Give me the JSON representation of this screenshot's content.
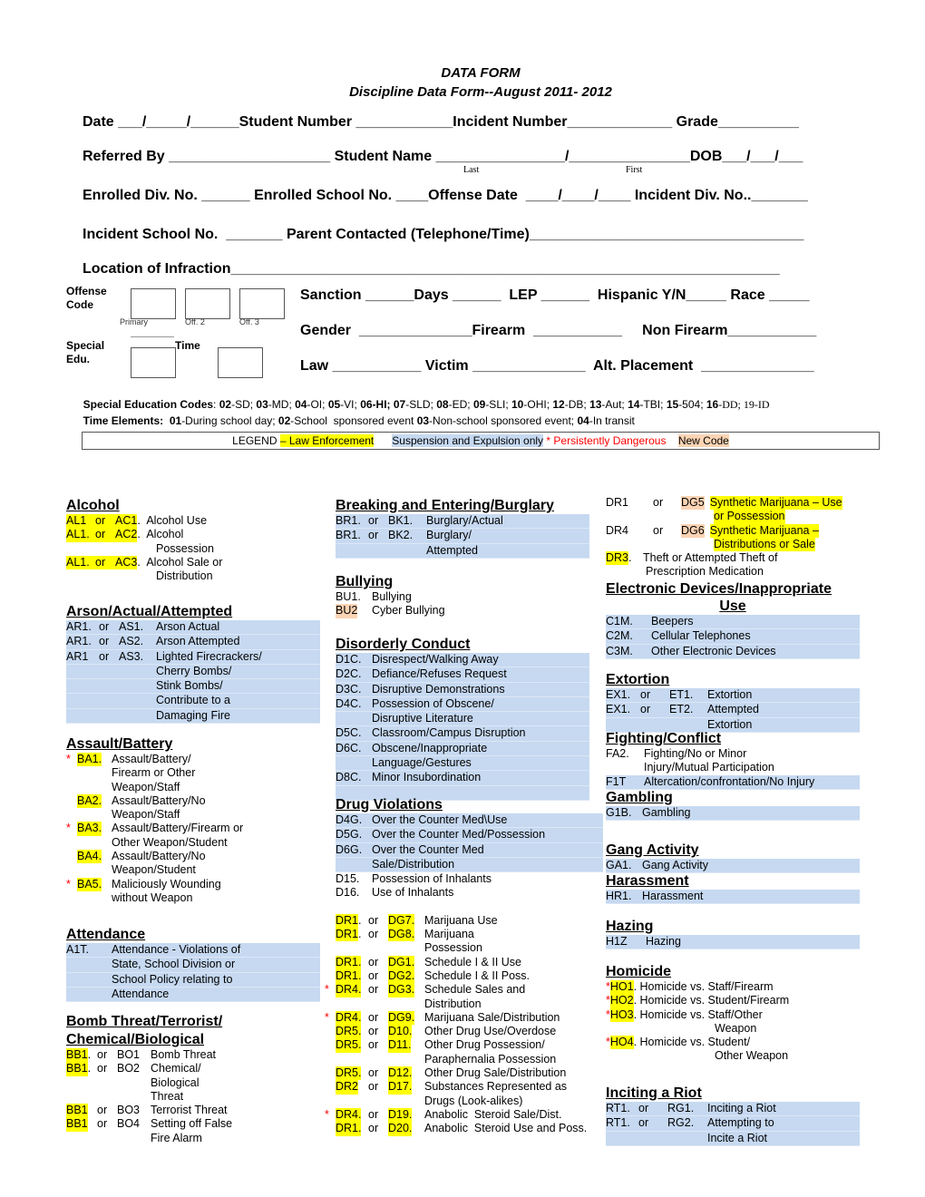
{
  "header": {
    "title": "DATA FORM",
    "subtitle": "Discipline Data Form--August 2011- 2012"
  },
  "form_rows": [
    "Date ___/_____/______Student Number ____________Incident Number_____________ Grade__________",
    "Referred By ____________________ Student Name ________________/_______________DOB___/___/___",
    "Enrolled Div. No. ______ Enrolled School No. ____Offense Date  ____/____/____ Incident Div. No.._______",
    "Incident School No.  _______ Parent Contacted (Telephone/Time)__________________________________",
    "Location of Infraction____________________________________________________________________"
  ],
  "name_sublabels": {
    "last": "Last",
    "first": "First"
  },
  "offense_code": {
    "label_line1": "Offense",
    "label_line2": "Code",
    "boxes": [
      "Primary",
      "Off. 2",
      "Off. 3"
    ]
  },
  "special_edu": {
    "label_line1": "Special",
    "label_line2": "Edu.",
    "time_label": "Time"
  },
  "right_fields": [
    "Sanction ______Days ______  LEP ______  Hispanic Y/N_____ Race _____",
    "Gender  ______________Firearm  ___________     Non Firearm___________",
    "Law ___________ Victim ______________  Alt. Placement  ______________"
  ],
  "special_education_codes": {
    "label": "Special Education Codes",
    "items": [
      {
        "code": "02",
        "desc": "SD"
      },
      {
        "code": "03",
        "desc": "MD"
      },
      {
        "code": "04",
        "desc": "OI"
      },
      {
        "code": "05",
        "desc": "VI"
      },
      {
        "code": "06",
        "desc": "HI"
      },
      {
        "code": "07",
        "desc": "SLD"
      },
      {
        "code": "08",
        "desc": "ED"
      },
      {
        "code": "09",
        "desc": "SLI"
      },
      {
        "code": "10",
        "desc": "OHI"
      },
      {
        "code": "12",
        "desc": "DB"
      },
      {
        "code": "13",
        "desc": "Aut"
      },
      {
        "code": "14",
        "desc": "TBI"
      },
      {
        "code": "15",
        "desc": "504"
      },
      {
        "code": "16",
        "desc": "DD"
      },
      {
        "code": "19",
        "desc": "ID"
      }
    ]
  },
  "time_elements": {
    "label": "Time Elements:",
    "items": [
      {
        "code": "01",
        "desc": "During school day; "
      },
      {
        "code": "02",
        "desc": "School  sponsored event "
      },
      {
        "code": "03",
        "desc": "Non-school sponsored event; "
      },
      {
        "code": "04",
        "desc": "In transit"
      }
    ]
  },
  "legend": {
    "label": "LEGEND",
    "law": "– Law Enforcement",
    "suspension": "Suspension and Expulsion only",
    "dangerous": "* Persistently Dangerous",
    "new_code": "New Code"
  },
  "colors": {
    "law_enforcement": "#ffff00",
    "suspension_expulsion": "#c6d9f1",
    "persistently_dangerous": "#ff0000",
    "new_code": "#fbd4b4"
  },
  "sections": {
    "alcohol": {
      "title": "Alcohol",
      "rows": [
        {
          "a": "AL1",
          "or": "or",
          "b": "AC1",
          "desc": "Alcohol Use"
        },
        {
          "a": "AL1.",
          "or": "or",
          "b": "AC2",
          "desc": "Alcohol"
        },
        {
          "a": "",
          "or": "",
          "b": "",
          "desc": "Possession"
        },
        {
          "a": "AL1.",
          "or": "or",
          "b": "AC3",
          "desc": "Alcohol Sale or"
        },
        {
          "a": "",
          "or": "",
          "b": "",
          "desc": "Distribution"
        }
      ]
    },
    "arson": {
      "title": "Arson/Actual/Attempted",
      "rows": [
        {
          "a": "AR1.",
          "or": "or",
          "b": "AS1.",
          "desc": "Arson Actual"
        },
        {
          "a": "AR1.",
          "or": "or",
          "b": "AS2.",
          "desc": "Arson Attempted"
        },
        {
          "a": "AR1",
          "or": "or",
          "b": "AS3.",
          "desc": "Lighted Firecrackers/"
        },
        {
          "a": "",
          "or": "",
          "b": "",
          "desc": "Cherry Bombs/"
        },
        {
          "a": "",
          "or": "",
          "b": "",
          "desc": "Stink Bombs/"
        },
        {
          "a": "",
          "or": "",
          "b": "",
          "desc": "Contribute to a"
        },
        {
          "a": "",
          "or": "",
          "b": "",
          "desc": "Damaging Fire"
        }
      ]
    },
    "assault": {
      "title": "Assault/Battery",
      "rows": [
        {
          "mark": "*",
          "code": "BA1.",
          "desc": "Assault/Battery/"
        },
        {
          "mark": "",
          "code": "",
          "desc": "Firearm or Other"
        },
        {
          "mark": "",
          "code": "",
          "desc": "Weapon/Staff"
        },
        {
          "mark": "",
          "code": "BA2.",
          "desc": "Assault/Battery/No"
        },
        {
          "mark": "",
          "code": "",
          "desc": "Weapon/Staff"
        },
        {
          "mark": "*",
          "code": "BA3.",
          "desc": "Assault/Battery/Firearm or"
        },
        {
          "mark": "",
          "code": "",
          "desc": "Other Weapon/Student"
        },
        {
          "mark": "",
          "code": "BA4.",
          "desc": "Assault/Battery/No"
        },
        {
          "mark": "",
          "code": "",
          "desc": "Weapon/Student"
        },
        {
          "mark": "*",
          "code": "BA5.",
          "desc": "Maliciously Wounding"
        },
        {
          "mark": "",
          "code": "",
          "desc": "without Weapon"
        }
      ]
    },
    "attendance": {
      "title": "Attendance",
      "rows": [
        {
          "code": "A1T.",
          "desc": "Attendance - Violations of"
        },
        {
          "code": "",
          "desc": "State, School Division or"
        },
        {
          "code": "",
          "desc": "School Policy relating to"
        },
        {
          "code": "",
          "desc": "Attendance"
        }
      ]
    },
    "bomb": {
      "title_line1": "Bomb Threat/Terrorist/",
      "title_line2": "Chemical/Biological",
      "rows": [
        {
          "a": "BB1",
          "dot": ".",
          "or": "or",
          "b": "BO1",
          "desc": "Bomb Threat"
        },
        {
          "a": "BB1",
          "dot": ".",
          "or": "or",
          "b": "BO2",
          "desc": "Chemical/"
        },
        {
          "a": "",
          "dot": "",
          "or": "",
          "b": "",
          "desc": "Biological"
        },
        {
          "a": "",
          "dot": "",
          "or": "",
          "b": "",
          "desc": "Threat"
        },
        {
          "a": "BB1",
          "dot": "",
          "or": "or",
          "b": "BO3",
          "desc": "Terrorist Threat"
        },
        {
          "a": "BB1",
          "dot": "",
          "or": "or",
          "b": "BO4",
          "desc": "Setting off False"
        },
        {
          "a": "",
          "dot": "",
          "or": "",
          "b": "",
          "desc": "Fire Alarm"
        }
      ]
    },
    "breaking": {
      "title": "Breaking and Entering/Burglary",
      "rows": [
        {
          "a": "BR1.",
          "or": "or",
          "b": "BK1.",
          "desc": "Burglary/Actual"
        },
        {
          "a": "BR1.",
          "or": "or",
          "b": "BK2.",
          "desc": "Burglary/"
        },
        {
          "a": "",
          "or": "",
          "b": "",
          "desc": "Attempted"
        }
      ]
    },
    "bullying": {
      "title": "Bullying",
      "rows": [
        {
          "code": "BU1.",
          "desc": "Bullying",
          "new": false
        },
        {
          "code": "BU2",
          "desc": "Cyber Bullying",
          "new": true
        }
      ]
    },
    "disorderly": {
      "title": "Disorderly Conduct",
      "rows": [
        {
          "code": "D1C.",
          "desc": "Disrespect/Walking Away"
        },
        {
          "code": "D2C.",
          "desc": "Defiance/Refuses Request"
        },
        {
          "code": "D3C.",
          "desc": "Disruptive Demonstrations"
        },
        {
          "code": "D4C.",
          "desc": "Possession of Obscene/"
        },
        {
          "code": "",
          "desc": "Disruptive Literature"
        },
        {
          "code": "D5C.",
          "desc": "Classroom/Campus Disruption"
        },
        {
          "code": "D6C.",
          "desc": "Obscene/Inappropriate"
        },
        {
          "code": "",
          "desc": "Language/Gestures"
        },
        {
          "code": "D8C.",
          "desc": "Minor Insubordination"
        },
        {
          "code": "",
          "desc": ""
        }
      ]
    },
    "drug": {
      "title": "Drug Violations",
      "otc_rows": [
        {
          "code": "D4G.",
          "desc": "Over the Counter Med\\Use",
          "blue": true
        },
        {
          "code": "D5G.",
          "desc": "Over the Counter Med/Possession",
          "blue": true
        },
        {
          "code": "D6G.",
          "desc": "Over the Counter Med",
          "blue": true
        },
        {
          "code": "",
          "desc": "Sale/Distribution",
          "blue": true
        },
        {
          "code": "D15.",
          "desc": "Possession of Inhalants",
          "blue": false
        },
        {
          "code": "D16.",
          "desc": "Use of Inhalants",
          "blue": false
        }
      ],
      "rows": [
        {
          "mark": "",
          "a": "DR1",
          "dot": ".",
          "or": "or",
          "b": "DG7.",
          "desc": "Marijuana Use"
        },
        {
          "mark": "",
          "a": "DR1",
          "dot": ".",
          "or": "or",
          "b": "DG8.",
          "desc": "Marijuana"
        },
        {
          "mark": "",
          "a": "",
          "dot": "",
          "or": "",
          "b": "",
          "desc": "Possession"
        },
        {
          "mark": "",
          "a": "DR1.",
          "dot": "",
          "or": "or",
          "b": "DG1.",
          "desc": "Schedule I & II Use"
        },
        {
          "mark": "",
          "a": "DR1.",
          "dot": "",
          "or": "or",
          "b": "DG2.",
          "desc": "Schedule I & II Poss."
        },
        {
          "mark": "*",
          "a": "DR4.",
          "dot": "",
          "or": "or",
          "b": "DG3.",
          "desc": "Schedule Sales and"
        },
        {
          "mark": "",
          "a": "",
          "dot": "",
          "or": "",
          "b": "",
          "desc": "Distribution"
        },
        {
          "mark": "*",
          "a": "DR4.",
          "dot": "",
          "or": "or",
          "b": "DG9.",
          "desc": "Marijuana Sale/Distribution"
        },
        {
          "mark": "",
          "a": "DR5.",
          "dot": "",
          "or": "or",
          "b": "D10.",
          "desc": "Other Drug Use/Overdose"
        },
        {
          "mark": "",
          "a": "DR5.",
          "dot": "",
          "or": "or",
          "b": "D11.",
          "desc": "Other Drug Possession/"
        },
        {
          "mark": "",
          "a": "",
          "dot": "",
          "or": "",
          "b": "",
          "desc": "Paraphernalia Possession"
        },
        {
          "mark": "",
          "a": "DR5.",
          "dot": "",
          "or": "or",
          "b": "D12.",
          "desc": "Other Drug Sale/Distribution"
        },
        {
          "mark": "",
          "a": "DR2",
          "dot": "",
          "or": "or",
          "b": "D17.",
          "desc": "Substances Represented as"
        },
        {
          "mark": "",
          "a": "",
          "dot": "",
          "or": "",
          "b": "",
          "desc": "Drugs (Look-alikes)"
        },
        {
          "mark": "*",
          "a": "DR4.",
          "dot": "",
          "or": "or",
          "b": "D19.",
          "desc": "Anabolic  Steroid Sale/Dist."
        },
        {
          "mark": "",
          "a": "DR1.",
          "dot": "",
          "or": "or",
          "b": "D20.",
          "desc": "Anabolic  Steroid Use and Poss."
        }
      ],
      "continued": [
        {
          "a": "DR1",
          "or": "or",
          "b": "DG5",
          "desc1": "Synthetic Marijuana – Use",
          "desc2": "or Possession"
        },
        {
          "a": "DR4",
          "or": "or",
          "b": "DG6",
          "desc1": "Synthetic Marijuana –",
          "desc2": "Distributions or Sale"
        }
      ],
      "dr3": {
        "code": "DR3",
        "dot": ".",
        "desc1": "Theft or Attempted Theft of",
        "desc2": "Prescription Medication"
      }
    },
    "electronic": {
      "title_line1": "Electronic Devices/Inappropriate",
      "title_line2": "Use",
      "rows": [
        {
          "code": "C1M.",
          "desc": "Beepers"
        },
        {
          "code": "C2M.",
          "desc": "Cellular Telephones"
        },
        {
          "code": "C3M.",
          "desc": "Other Electronic Devices"
        }
      ]
    },
    "extortion": {
      "title": "Extortion",
      "rows": [
        {
          "a": "EX1.",
          "or": "or",
          "b": "ET1.",
          "desc": "Extortion"
        },
        {
          "a": "EX1.",
          "or": "or",
          "b": "ET2.",
          "desc": "Attempted"
        },
        {
          "a": "",
          "or": "",
          "b": "",
          "desc": "Extortion"
        }
      ]
    },
    "fighting": {
      "title": "Fighting/Conflict",
      "rows": [
        {
          "code": "FA2.",
          "desc": "Fighting/No or Minor",
          "blue": false
        },
        {
          "code": "",
          "desc": "Injury/Mutual Participation",
          "blue": false
        },
        {
          "code": "F1T",
          "desc": "Altercation/confrontation/No Injury",
          "blue": true
        }
      ]
    },
    "gambling": {
      "title": "Gambling",
      "rows": [
        {
          "code": "G1B.",
          "desc": "Gambling"
        }
      ]
    },
    "gang": {
      "title": "Gang Activity",
      "rows": [
        {
          "code": "GA1.",
          "desc": "Gang Activity"
        }
      ]
    },
    "harassment": {
      "title": "Harassment",
      "rows": [
        {
          "code": "HR1.",
          "desc": "Harassment"
        }
      ]
    },
    "hazing": {
      "title": "Hazing",
      "rows": [
        {
          "code": "H1Z",
          "desc": "Hazing"
        }
      ]
    },
    "homicide": {
      "title": "Homicide",
      "rows": [
        {
          "mark": "*",
          "code": "HO1",
          "desc": ". Homicide vs. Staff/Firearm"
        },
        {
          "mark": "*",
          "code": "HO2",
          "desc": ". Homicide vs. Student/Firearm"
        },
        {
          "mark": "*",
          "code": "HO3",
          "desc": ". Homicide vs. Staff/Other"
        },
        {
          "mark": "",
          "code": "",
          "desc": "Weapon"
        },
        {
          "mark": "*",
          "code": "HO4",
          "desc": ". Homicide vs. Student/"
        },
        {
          "mark": "",
          "code": "",
          "desc": "Other Weapon"
        }
      ]
    },
    "riot": {
      "title": "Inciting a Riot",
      "rows": [
        {
          "a": "RT1.",
          "or": "or",
          "b": "RG1.",
          "desc": "Inciting a Riot"
        },
        {
          "a": "RT1.",
          "or": "or",
          "b": "RG2.",
          "desc": "Attempting to"
        },
        {
          "a": "",
          "or": "",
          "b": "",
          "desc": "Incite a Riot"
        }
      ]
    }
  }
}
